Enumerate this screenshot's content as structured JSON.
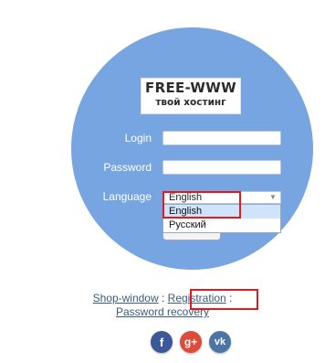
{
  "logo": {
    "line1": "FREE-WWW",
    "line2": "твой хостинг"
  },
  "form": {
    "login_label": "Login",
    "password_label": "Password",
    "language_label": "Language",
    "language_selected": "English",
    "language_options": [
      "English",
      "Русский"
    ]
  },
  "footer": {
    "shop_window": "Shop-window",
    "separator1": " : ",
    "registration": "Registration",
    "separator2": " :",
    "password_recovery": "Password recovery"
  },
  "social": {
    "facebook": {
      "glyph": "f",
      "icon": "facebook-icon",
      "color": "#3b5998"
    },
    "google_plus": {
      "glyph": "g+",
      "icon": "google-plus-icon",
      "color": "#dd4b39"
    },
    "vk": {
      "glyph": "vk",
      "icon": "vk-icon",
      "color": "#4c75a3"
    }
  },
  "colors": {
    "circle": "#76a5e1",
    "highlight": "#e01b1b",
    "selected_option": "#cfe3fb"
  }
}
